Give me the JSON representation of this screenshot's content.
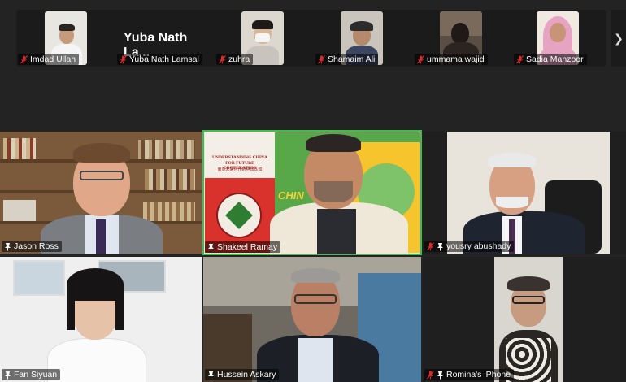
{
  "strip": {
    "participants": [
      {
        "name": "Imdad Ullah"
      },
      {
        "name": "Yuba Nath Lamsal",
        "display_name": "Yuba Nath La..."
      },
      {
        "name": "zuhra"
      },
      {
        "name": "Shamaim Ali"
      },
      {
        "name": "ummama wajid"
      },
      {
        "name": "Sadia Manzoor"
      }
    ],
    "next_icon": "chevron-right-icon"
  },
  "gallery": {
    "tiles": [
      {
        "name": "Jason Ross",
        "pinned": true
      },
      {
        "name": "Shakeel Ramay",
        "pinned": true,
        "active_speaker": true
      },
      {
        "name": "yousry abushady",
        "muted": true,
        "pinned": true
      },
      {
        "name": "Fan Siyuan",
        "pinned": true
      },
      {
        "name": "Hussein Askary",
        "pinned": true
      },
      {
        "name": "Romina's iPhone",
        "muted": true,
        "pinned": true
      }
    ],
    "book": {
      "title": "UNDERSTANDING CHINA FOR FUTURE COOPERATION",
      "title_line2": "FOR FUTURE COOPERATION",
      "subtitle": "面向未来合作的中国认知"
    }
  },
  "colors": {
    "active_speaker_border": "#3fbf4a",
    "mic_muted": "#e02828",
    "background": "#232323"
  }
}
